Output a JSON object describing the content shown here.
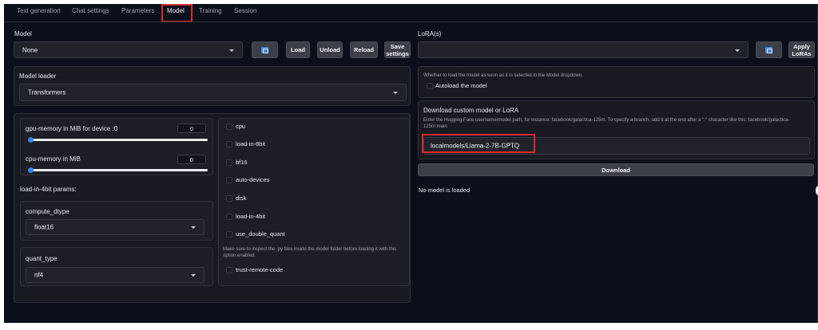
{
  "tabs": [
    "Text generation",
    "Chat settings",
    "Parameters",
    "Model",
    "Training",
    "Session"
  ],
  "model": {
    "label": "Model",
    "selected": "None",
    "buttons": {
      "load": "Load",
      "unload": "Unload",
      "reload": "Reload",
      "save_settings": "Save settings"
    }
  },
  "lora": {
    "label": "LoRA(s)",
    "selected": "",
    "apply_button": "Apply LoRAs"
  },
  "model_loader": {
    "label": "Model loader",
    "selected": "Transformers"
  },
  "autoload": {
    "description": "Whether to load the model as soon as it is selected in the Model dropdown.",
    "label": "Autoload the model"
  },
  "download": {
    "title": "Download custom model or LoRA",
    "description": "Enter the Hugging Face username/model path, for instance: facebook/galactica-125m. To specify a branch, add it at the end after a \":\" character like this: facebook/galactica-125m:main",
    "value": "localmodels/Llama-2-7B-GPTQ",
    "button": "Download"
  },
  "status": "No model is loaded",
  "sliders": [
    {
      "label": "gpu-memory in MiB for device :0",
      "value": "0",
      "fraction": 0
    },
    {
      "label": "cpu-memory in MiB",
      "value": "0",
      "fraction": 0
    }
  ],
  "load4bit": {
    "label": "load-in-4bit params:",
    "compute_dtype": {
      "label": "compute_dtype",
      "value": "float16"
    },
    "quant_type": {
      "label": "quant_type",
      "value": "nf4"
    }
  },
  "checkboxes": [
    "cpu",
    "load-in-8bit",
    "bf16",
    "auto-devices",
    "disk",
    "load-in-4bit",
    "use_double_quant"
  ],
  "trust": {
    "note": "Make sure to inspect the .py files inside the model folder before loading it with this option enabled.",
    "label": "trust-remote-code"
  },
  "colors": {
    "background": "#0b0f19",
    "panel": "#171a21",
    "accent": "#3b82f6",
    "highlight": "#d92b2b"
  },
  "icons": [
    "refresh-icon",
    "chevron-down-icon"
  ]
}
